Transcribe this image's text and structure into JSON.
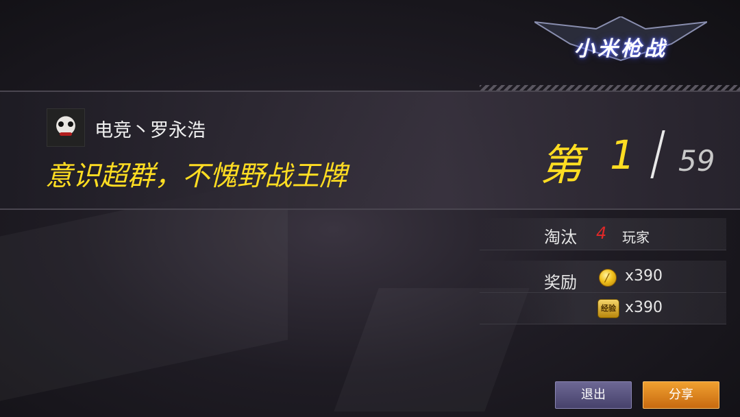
{
  "logo": {
    "text": "小米枪战"
  },
  "player": {
    "name": "电竞丶罗永浩",
    "slogan": "意识超群，不愧野战王牌"
  },
  "rank": {
    "prefix": "第",
    "position": "1",
    "total": "59"
  },
  "stats": {
    "eliminate_label": "淘汰",
    "eliminate_count": "4",
    "eliminate_unit": "玩家",
    "reward_label": "奖励",
    "coin_amount": "x390",
    "coin_icon": "gold-coin-icon",
    "exp_amount": "x390",
    "exp_icon": "experience-badge-icon",
    "exp_icon_text": "经验"
  },
  "buttons": {
    "exit": "退出",
    "share": "分享"
  },
  "colors": {
    "highlight": "#ffdd22",
    "danger": "#e02828",
    "share": "#e08a20",
    "exit": "#5b5680"
  }
}
